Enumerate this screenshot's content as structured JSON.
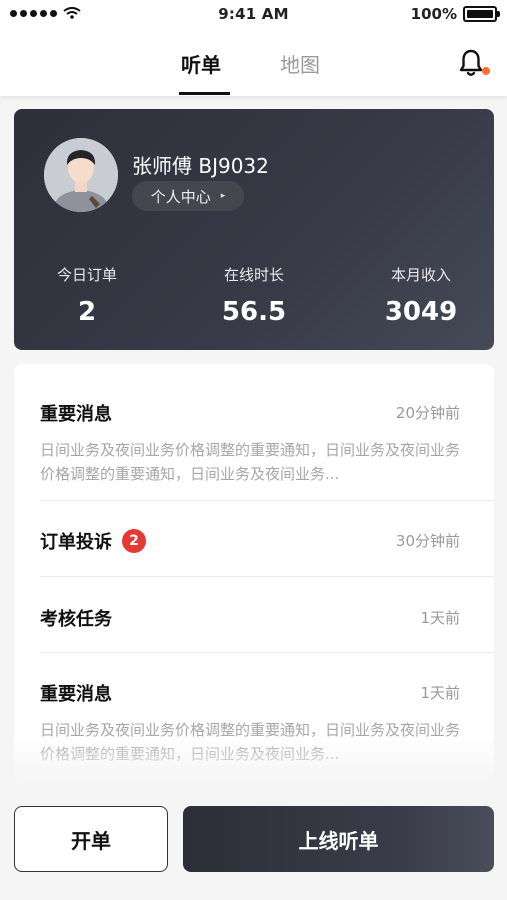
{
  "status_bar": {
    "time": "9:41 AM",
    "battery": "100%"
  },
  "nav": {
    "tabs": [
      {
        "label": "听单",
        "active": true
      },
      {
        "label": "地图",
        "active": false
      }
    ],
    "has_notification": true
  },
  "profile": {
    "name": "张师傅 BJ9032",
    "center_label": "个人中心",
    "stats": [
      {
        "label": "今日订单",
        "value": "2"
      },
      {
        "label": "在线时长",
        "value": "56.5"
      },
      {
        "label": "本月收入",
        "value": "3049"
      }
    ]
  },
  "messages": [
    {
      "title": "重要消息",
      "time": "20分钟前",
      "body": "日间业务及夜间业务价格调整的重要通知，日间业务及夜间业务价格调整的重要通知，日间业务及夜间业务..."
    },
    {
      "title": "订单投诉",
      "time": "30分钟前",
      "badge": "2"
    },
    {
      "title": "考核任务",
      "time": "1天前"
    },
    {
      "title": "重要消息",
      "time": "1天前",
      "body": "日间业务及夜间业务价格调整的重要通知，日间业务及夜间业务价格调整的重要通知，日间业务及夜间业务..."
    }
  ],
  "actions": {
    "open_order": "开单",
    "go_online": "上线听单"
  },
  "colors": {
    "accent_dark": "#2d2f3a",
    "badge_red": "#e53935",
    "notification_dot": "#ff6b2c"
  }
}
